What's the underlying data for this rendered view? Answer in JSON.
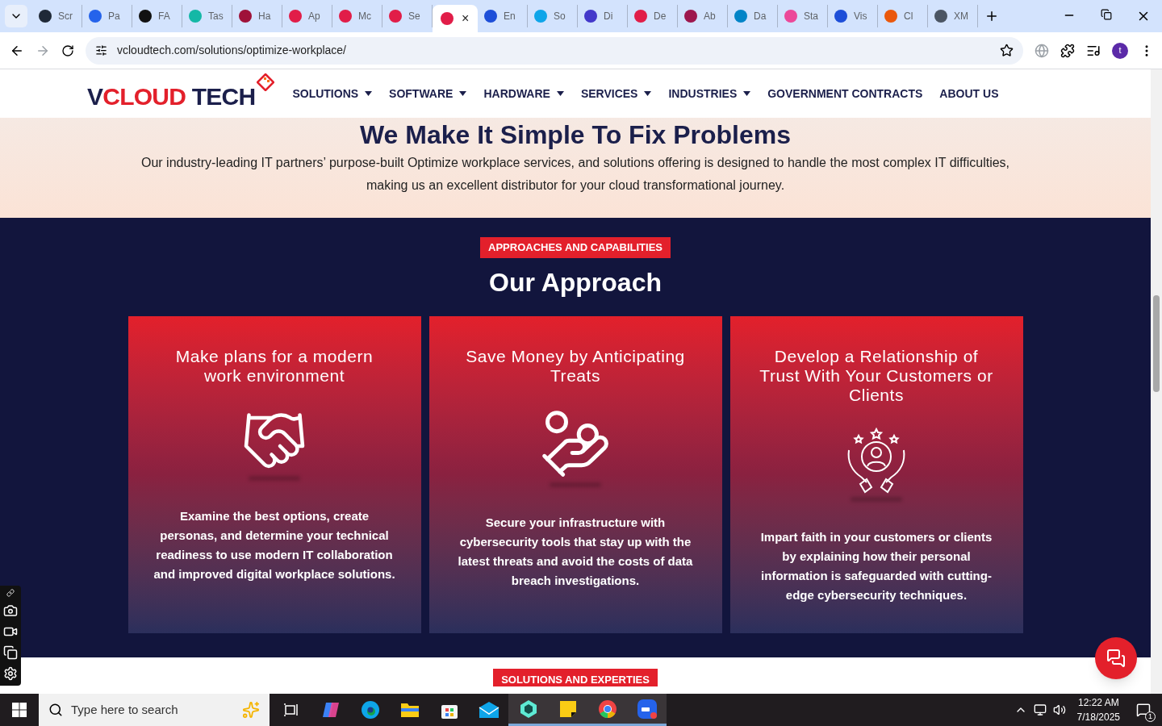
{
  "browser": {
    "tabs": [
      {
        "title": "Scr",
        "selected": false,
        "color": "#1f2937"
      },
      {
        "title": "Pa",
        "selected": false,
        "color": "#2563eb"
      },
      {
        "title": "FA",
        "selected": false,
        "color": "#111111"
      },
      {
        "title": "Tas",
        "selected": false,
        "color": "#14b8a6"
      },
      {
        "title": "Ha",
        "selected": false,
        "color": "#9f1239"
      },
      {
        "title": "Ap",
        "selected": false,
        "color": "#e11d48"
      },
      {
        "title": "Mc",
        "selected": false,
        "color": "#e11d48"
      },
      {
        "title": "Se",
        "selected": false,
        "color": "#e11d48"
      },
      {
        "selected": true,
        "color": "#e11d48",
        "close": "×"
      },
      {
        "title": "En",
        "selected": false,
        "color": "#1d4ed8"
      },
      {
        "title": "So",
        "selected": false,
        "color": "#0ea5e9"
      },
      {
        "title": "Di",
        "selected": false,
        "color": "#4338ca"
      },
      {
        "title": "De",
        "selected": false,
        "color": "#e11d48"
      },
      {
        "title": "Ab",
        "selected": false,
        "color": "#9d174d"
      },
      {
        "title": "Da",
        "selected": false,
        "color": "#0284c7"
      },
      {
        "title": "Sta",
        "selected": false,
        "color": "#ec4899"
      },
      {
        "title": "Vis",
        "selected": false,
        "color": "#1d4ed8"
      },
      {
        "title": "Cl",
        "selected": false,
        "color": "#ea580c"
      },
      {
        "title": "XM",
        "selected": false,
        "color": "#4b5563"
      }
    ],
    "address": "vcloudtech.com/solutions/optimize-workplace/",
    "profile": "t"
  },
  "site": {
    "logo": {
      "part_1": "V",
      "part_2": "CLOUD",
      "part_3": " TECH"
    },
    "nav": [
      {
        "label": "SOLUTIONS",
        "dropdown": true
      },
      {
        "label": "SOFTWARE",
        "dropdown": true
      },
      {
        "label": "HARDWARE",
        "dropdown": true
      },
      {
        "label": "SERVICES",
        "dropdown": true
      },
      {
        "label": "INDUSTRIES",
        "dropdown": true
      },
      {
        "label": "GOVERNMENT CONTRACTS",
        "dropdown": false
      },
      {
        "label": "ABOUT US",
        "dropdown": false
      }
    ],
    "intro": {
      "heading": "We Make It Simple To Fix Problems",
      "text": "Our industry-leading IT partners’ purpose-built Optimize workplace services, and solutions offering is designed to handle the most complex IT difficulties, making us an excellent distributor for your cloud transformational journey."
    },
    "approach": {
      "badge": "APPROACHES AND CAPABILITIES",
      "title": "Our Approach",
      "cards": [
        {
          "title": "Make plans for a modern work environment",
          "text": "Examine the best options, create personas, and determine your technical readiness to use modern IT collaboration and improved digital workplace solutions."
        },
        {
          "title": "Save Money by Anticipating Treats",
          "text": "Secure your infrastructure with cybersecurity tools that stay up with the latest threats and avoid the costs of data breach investigations."
        },
        {
          "title": "Develop a Relationship of Trust With Your Customers or Clients",
          "text": "Impart faith in your customers or clients by explaining how their personal information is safeguarded with cutting-edge cybersecurity techniques."
        }
      ]
    },
    "next_badge": "SOLUTIONS AND EXPERTIES"
  },
  "taskbar": {
    "search": {
      "placeholder": "Type here to search"
    },
    "apps": [
      {
        "kind": "taskview",
        "running": false
      },
      {
        "kind": "copilot",
        "running": false
      },
      {
        "kind": "edge",
        "running": false
      },
      {
        "kind": "files",
        "running": false
      },
      {
        "kind": "store",
        "running": false
      },
      {
        "kind": "mail",
        "running": false
      },
      {
        "kind": "cube",
        "running": true
      },
      {
        "kind": "notes",
        "running": true
      },
      {
        "kind": "chrome",
        "running": true
      },
      {
        "kind": "zoom",
        "running": true
      }
    ],
    "time": "12:22 AM",
    "date": "7/18/2025",
    "notifications": "1"
  }
}
